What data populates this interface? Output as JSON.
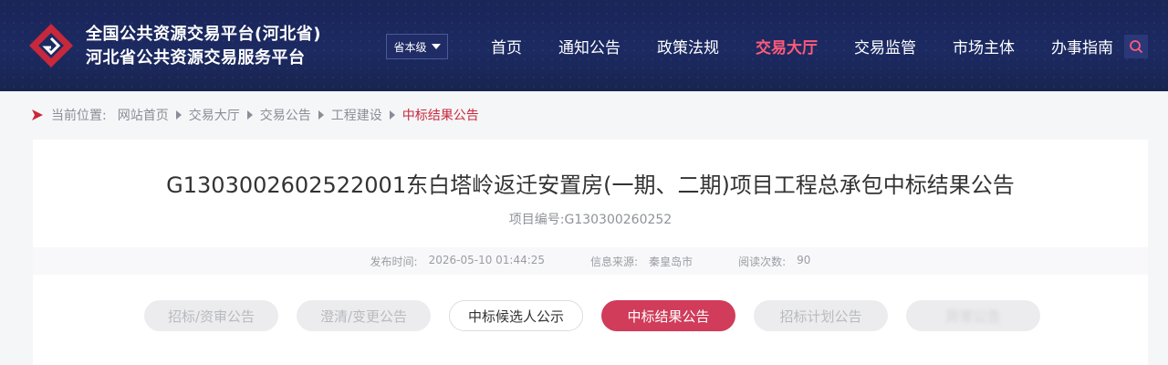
{
  "header": {
    "title_line1": "全国公共资源交易平台(河北省)",
    "title_line2": "河北省公共资源交易服务平台",
    "level_select": "省本级",
    "nav": [
      {
        "label": "首页"
      },
      {
        "label": "通知公告"
      },
      {
        "label": "政策法规"
      },
      {
        "label": "交易大厅"
      },
      {
        "label": "交易监管"
      },
      {
        "label": "市场主体"
      },
      {
        "label": "办事指南"
      }
    ],
    "active_nav": "交易大厅",
    "search_icon": "search-icon",
    "colors": {
      "bg": "#1c2a62",
      "active": "#ff5a7a"
    }
  },
  "breadcrumb": {
    "label": "当前位置:",
    "items": [
      "网站首页",
      "交易大厅",
      "交易公告",
      "工程建设"
    ],
    "current": "中标结果公告"
  },
  "article": {
    "title": "G1303002602522001东白塔岭返迁安置房(一期、二期)项目工程总承包中标结果公告",
    "project_no": "项目编号:G130300260252",
    "meta": {
      "publish_label": "发布时间:",
      "publish_time": "2026-05-10 01:44:25",
      "source_label": "信息来源:",
      "source": "秦皇岛市",
      "views_label": "阅读次数:",
      "views": "90"
    }
  },
  "tabs": [
    {
      "label": "招标/资审公告",
      "state": "disabled"
    },
    {
      "label": "澄清/变更公告",
      "state": "disabled"
    },
    {
      "label": "中标候选人公示",
      "state": "outline"
    },
    {
      "label": "中标结果公告",
      "state": "active"
    },
    {
      "label": "招标计划公告",
      "state": "disabled"
    },
    {
      "label": "异常公告",
      "state": "blurred"
    }
  ],
  "colors": {
    "accent": "#d03c5a",
    "breadcrumb_current": "#c8283c"
  }
}
